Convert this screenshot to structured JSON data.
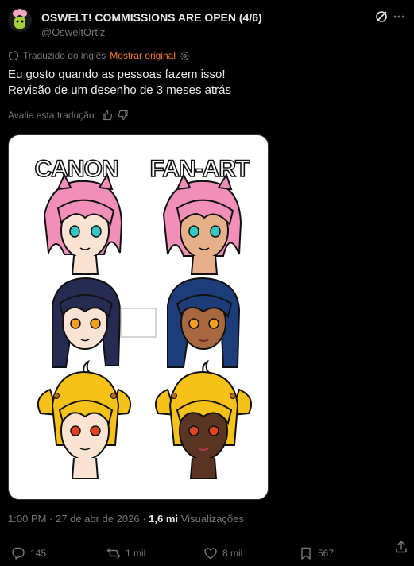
{
  "header": {
    "display_name": "OSWELT! COMMISSIONS ARE OPEN (4/6)",
    "handle": "@OsweltOrtiz"
  },
  "translation": {
    "label": "Traduzido do inglês",
    "show_original": "Mostrar original"
  },
  "tweet": {
    "line1": "Eu gosto quando as pessoas fazem isso!",
    "line2": "Revisão de um desenho de 3 meses atrás"
  },
  "rate": {
    "label": "Avalie esta tradução:"
  },
  "media": {
    "label_left": "CANON",
    "label_right": "FAN-ART"
  },
  "meta": {
    "time": "1:00 PM",
    "separator": "·",
    "date": "27 de abr de 2026",
    "views_count": "1,6 mi",
    "views_label": "Visualizações"
  },
  "actions": {
    "replies": "145",
    "reposts": "1 mil",
    "likes": "8 mil",
    "bookmarks": "567"
  },
  "colors": {
    "background": "#000000",
    "text": "#e7e9ea",
    "muted": "#71767b",
    "show_original": "#f4782a"
  }
}
